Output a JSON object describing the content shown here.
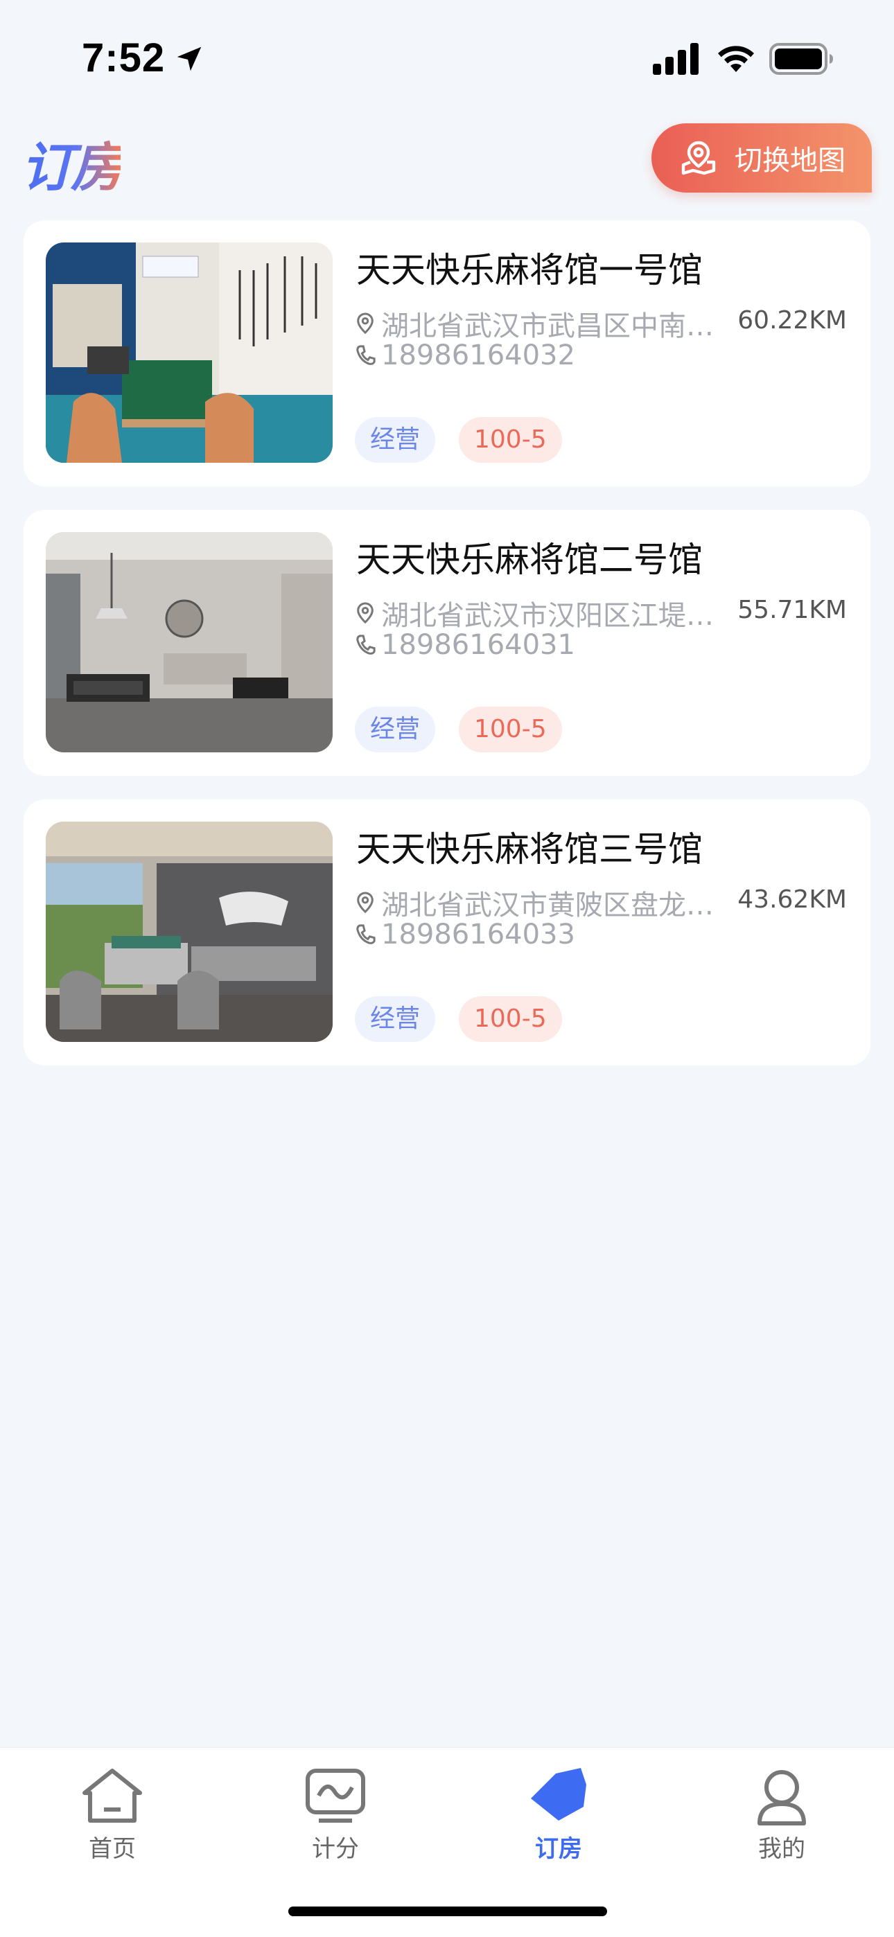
{
  "status_bar": {
    "time": "7:52"
  },
  "header": {
    "title": "订房",
    "map_button_label": "切换地图"
  },
  "colors": {
    "accent_blue": "#3d6cf2",
    "accent_orange": "#ea5f55",
    "tag_status_bg": "#eef2fd",
    "tag_rate_bg": "#fde9e5"
  },
  "venues": [
    {
      "name": "天天快乐麻将馆一号馆",
      "address": "湖北省武汉市武昌区中南…",
      "distance": "60.22KM",
      "phone": "18986164032",
      "status_tag": "经营",
      "rate_tag": "100-5"
    },
    {
      "name": "天天快乐麻将馆二号馆",
      "address": "湖北省武汉市汉阳区江堤…",
      "distance": "55.71KM",
      "phone": "18986164031",
      "status_tag": "经营",
      "rate_tag": "100-5"
    },
    {
      "name": "天天快乐麻将馆三号馆",
      "address": "湖北省武汉市黄陂区盘龙…",
      "distance": "43.62KM",
      "phone": "18986164033",
      "status_tag": "经营",
      "rate_tag": "100-5"
    }
  ],
  "tabbar": {
    "items": [
      {
        "label": "首页",
        "icon": "home-icon"
      },
      {
        "label": "计分",
        "icon": "score-icon"
      },
      {
        "label": "订房",
        "icon": "booking-icon",
        "active": true
      },
      {
        "label": "我的",
        "icon": "profile-icon"
      }
    ]
  }
}
